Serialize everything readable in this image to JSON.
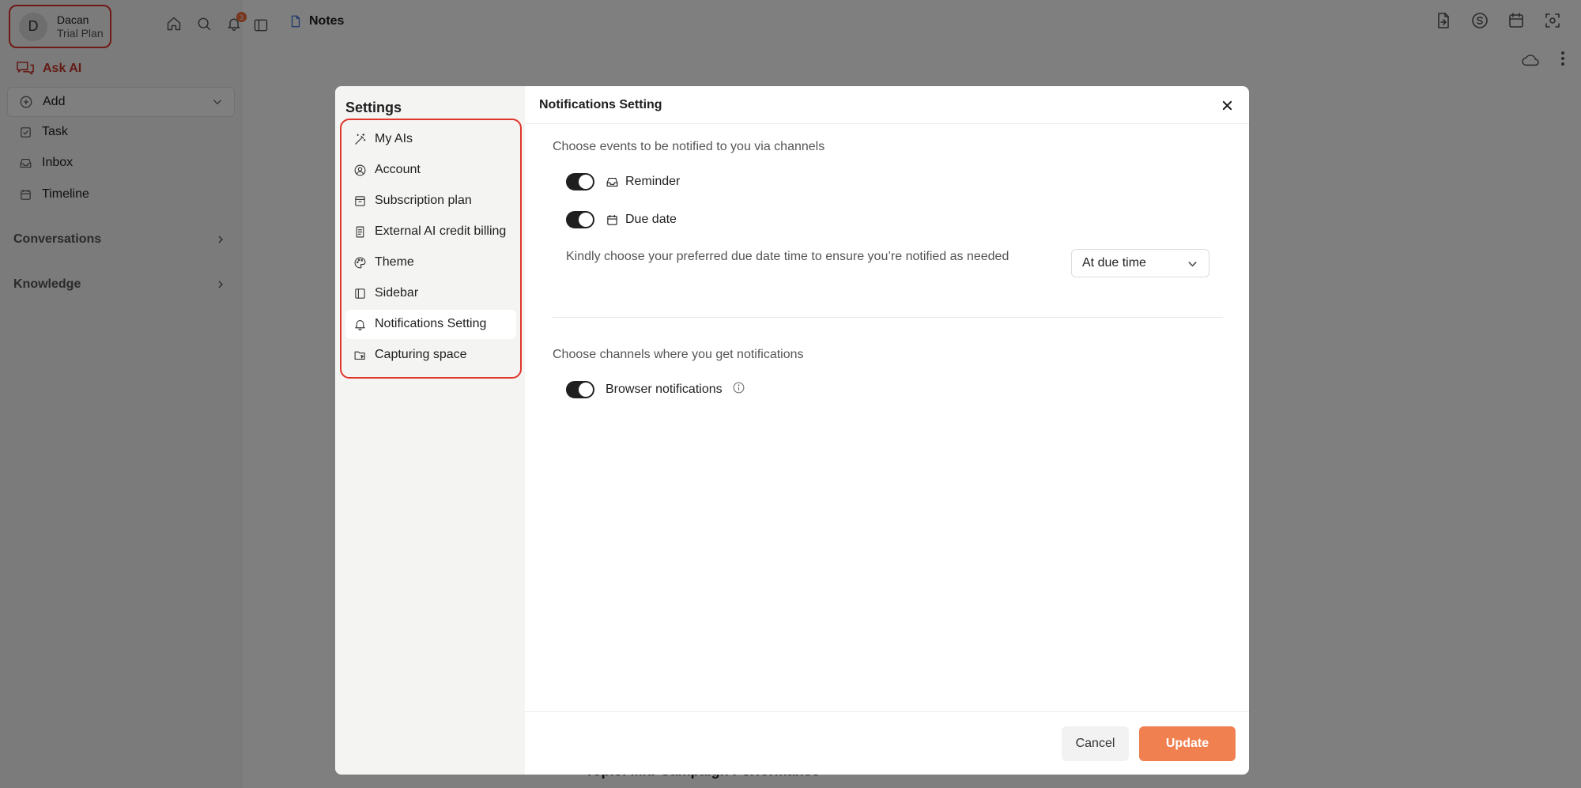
{
  "user": {
    "initial": "D",
    "name": "Dacan",
    "plan": "Trial Plan"
  },
  "header": {
    "notification_count": "3",
    "tab_title": "Notes"
  },
  "sidebar": {
    "ask_ai": "Ask AI",
    "add": "Add",
    "items": [
      {
        "label": "Task"
      },
      {
        "label": "Inbox"
      },
      {
        "label": "Timeline"
      }
    ],
    "sections": [
      {
        "label": "Conversations"
      },
      {
        "label": "Knowledge"
      }
    ]
  },
  "background": {
    "partial_text": "Topic: Mid-Campaign Performance"
  },
  "settings": {
    "title": "Settings",
    "menu": [
      {
        "label": "My AIs",
        "icon": "wand-icon"
      },
      {
        "label": "Account",
        "icon": "user-circle-icon"
      },
      {
        "label": "Subscription plan",
        "icon": "archive-icon"
      },
      {
        "label": "External AI credit billing",
        "icon": "receipt-icon"
      },
      {
        "label": "Theme",
        "icon": "palette-icon"
      },
      {
        "label": "Sidebar",
        "icon": "sidebar-icon"
      },
      {
        "label": "Notifications Setting",
        "icon": "bell-icon"
      },
      {
        "label": "Capturing space",
        "icon": "folder-capture-icon"
      }
    ],
    "active_index": 6
  },
  "panel": {
    "title": "Notifications Setting",
    "events_label": "Choose events to be notified to you via channels",
    "reminder_label": "Reminder",
    "due_date_label": "Due date",
    "due_help": "Kindly choose your preferred due date time to ensure you’re notified as needed",
    "due_select_value": "At due time",
    "channels_label": "Choose channels where you get notifications",
    "browser_label": "Browser notifications",
    "toggles": {
      "reminder": true,
      "due_date": true,
      "browser": true
    }
  },
  "footer": {
    "cancel": "Cancel",
    "update": "Update"
  },
  "colors": {
    "accent": "#f08050",
    "highlight_border": "#e0352b",
    "ask_ai": "#c8372b"
  }
}
